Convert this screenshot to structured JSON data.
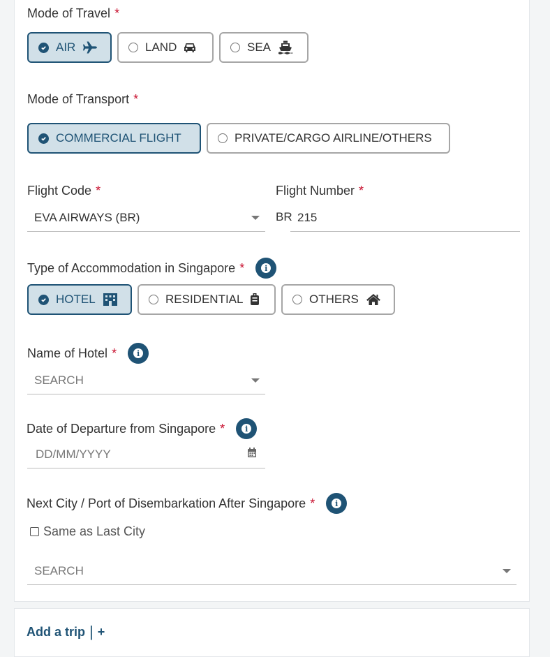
{
  "mode_of_travel": {
    "label": "Mode of Travel",
    "required": "*",
    "options": [
      {
        "label": "AIR",
        "selected": true,
        "icon": "plane-icon"
      },
      {
        "label": "LAND",
        "selected": false,
        "icon": "car-icon"
      },
      {
        "label": "SEA",
        "selected": false,
        "icon": "ship-icon"
      }
    ]
  },
  "mode_of_transport": {
    "label": "Mode of Transport",
    "required": "*",
    "options": [
      {
        "label": "COMMERCIAL FLIGHT",
        "selected": true
      },
      {
        "label": "PRIVATE/CARGO AIRLINE/OTHERS",
        "selected": false
      }
    ]
  },
  "flight_code": {
    "label": "Flight Code",
    "required": "*",
    "value": "EVA AIRWAYS (BR)"
  },
  "flight_number": {
    "label": "Flight Number",
    "required": "*",
    "prefix": "BR",
    "value": "215"
  },
  "accommodation": {
    "label": "Type of Accommodation in Singapore",
    "required": "*",
    "options": [
      {
        "label": "HOTEL",
        "selected": true,
        "icon": "building-icon"
      },
      {
        "label": "RESIDENTIAL",
        "selected": false,
        "icon": "luggage-icon"
      },
      {
        "label": "OTHERS",
        "selected": false,
        "icon": "home-icon"
      }
    ]
  },
  "hotel_name": {
    "label": "Name of Hotel",
    "required": "*",
    "placeholder": "SEARCH"
  },
  "departure_date": {
    "label": "Date of Departure from Singapore",
    "required": "*",
    "placeholder": "DD/MM/YYYY"
  },
  "next_city": {
    "label": "Next City / Port of Disembarkation After Singapore",
    "required": "*",
    "same_as_last": "Same as Last City",
    "placeholder": "SEARCH"
  },
  "add_trip": {
    "label": "Add a trip",
    "separator": "|",
    "plus": "+"
  },
  "colors": {
    "accent": "#1f5375",
    "selected_bg": "#d1e0e8",
    "required": "#c8102e"
  }
}
